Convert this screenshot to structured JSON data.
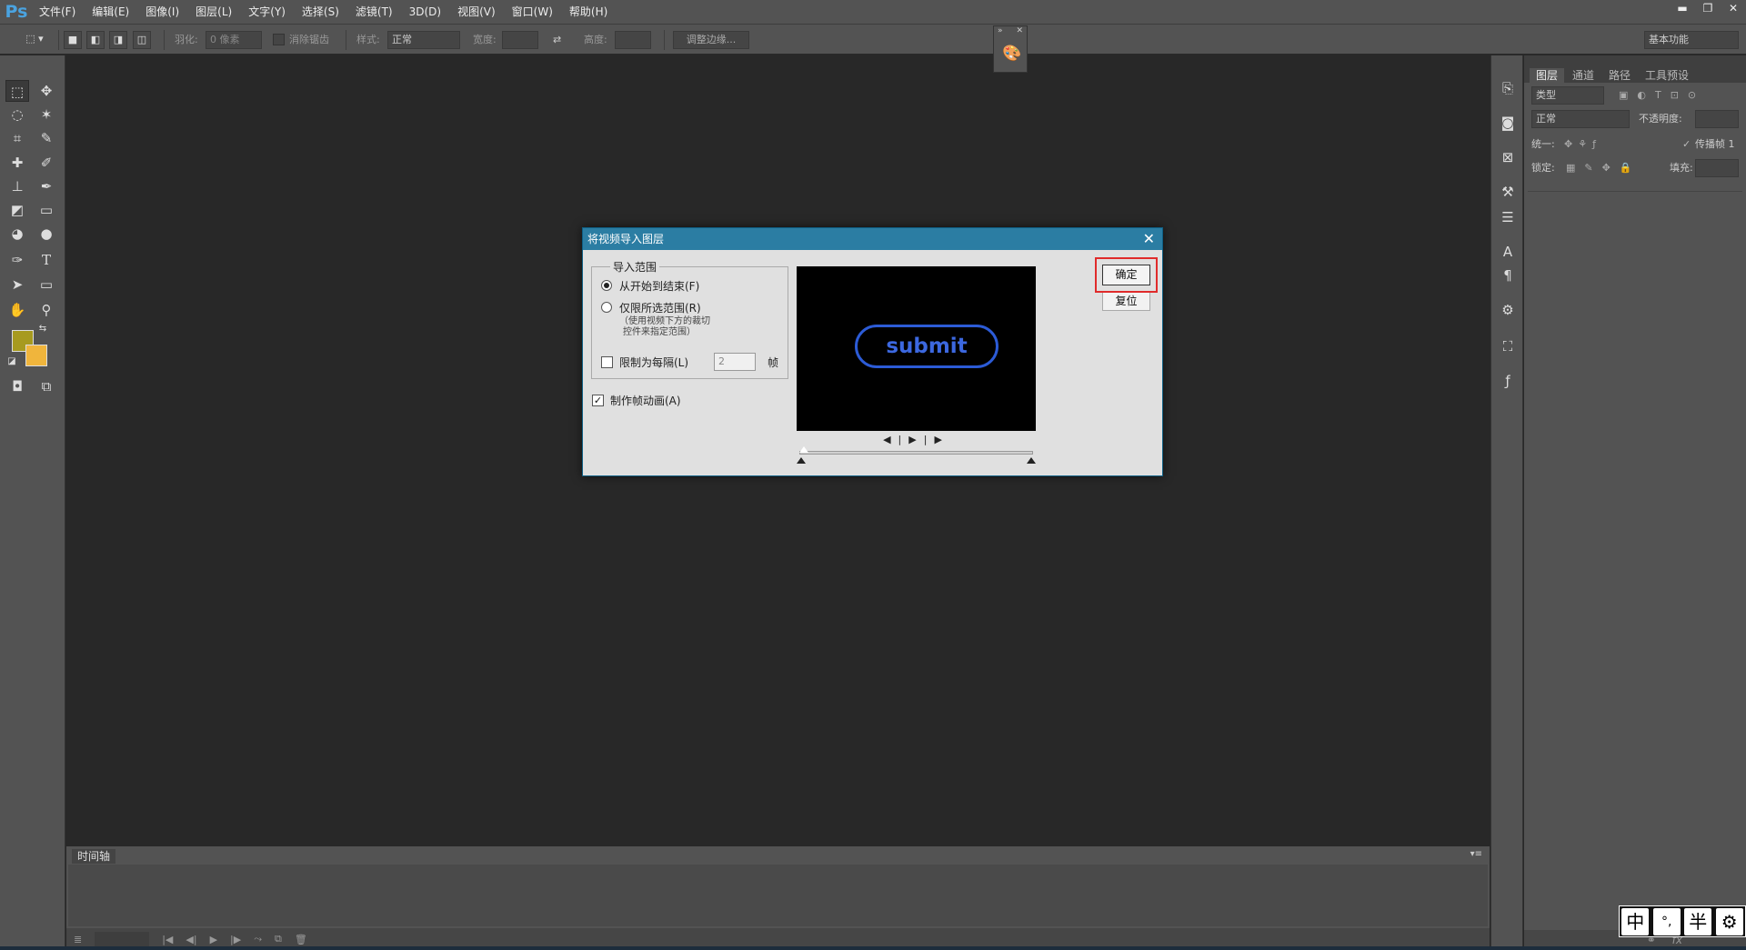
{
  "app": {
    "logo": "Ps"
  },
  "menu": [
    "文件(F)",
    "编辑(E)",
    "图像(I)",
    "图层(L)",
    "文字(Y)",
    "选择(S)",
    "滤镜(T)",
    "3D(D)",
    "视图(V)",
    "窗口(W)",
    "帮助(H)"
  ],
  "window_controls": {
    "minimize": "▬",
    "restore": "❐",
    "close": "✕"
  },
  "options": {
    "feather_label": "羽化:",
    "feather_value": "0 像素",
    "antialias_label": "消除锯齿",
    "style_label": "样式:",
    "style_value": "正常",
    "width_label": "宽度:",
    "height_label": "高度:",
    "refine_edge": "调整边缘...",
    "workspace": "基本功能"
  },
  "timeline": {
    "tab": "时间轴"
  },
  "panels": {
    "tabs": [
      "图层",
      "通道",
      "路径",
      "工具预设"
    ],
    "kind_filter": "类型",
    "blend_mode": "正常",
    "opacity_label": "不透明度:",
    "unify_label": "统一:",
    "propagate_label": "传播帧 1",
    "lock_label": "锁定:",
    "fill_label": "填充:"
  },
  "dialog": {
    "title": "将视频导入图层",
    "group_label": "导入范围",
    "option_all": "从开始到结束(F)",
    "option_selected": "仅限所选范围(R)",
    "option_note_1": "（使用视频下方的裁切",
    "option_note_2": "控件来指定范围）",
    "limit_label": "限制为每隔(L)",
    "limit_value": "2",
    "frame_unit": "帧",
    "make_animation": "制作帧动画(A)",
    "ok": "确定",
    "reset": "复位",
    "preview_text": "submit",
    "range_all_selected": true,
    "limit_checked": false,
    "animation_checked": true
  },
  "ime": [
    "中",
    "°,",
    "半",
    "⚙"
  ]
}
